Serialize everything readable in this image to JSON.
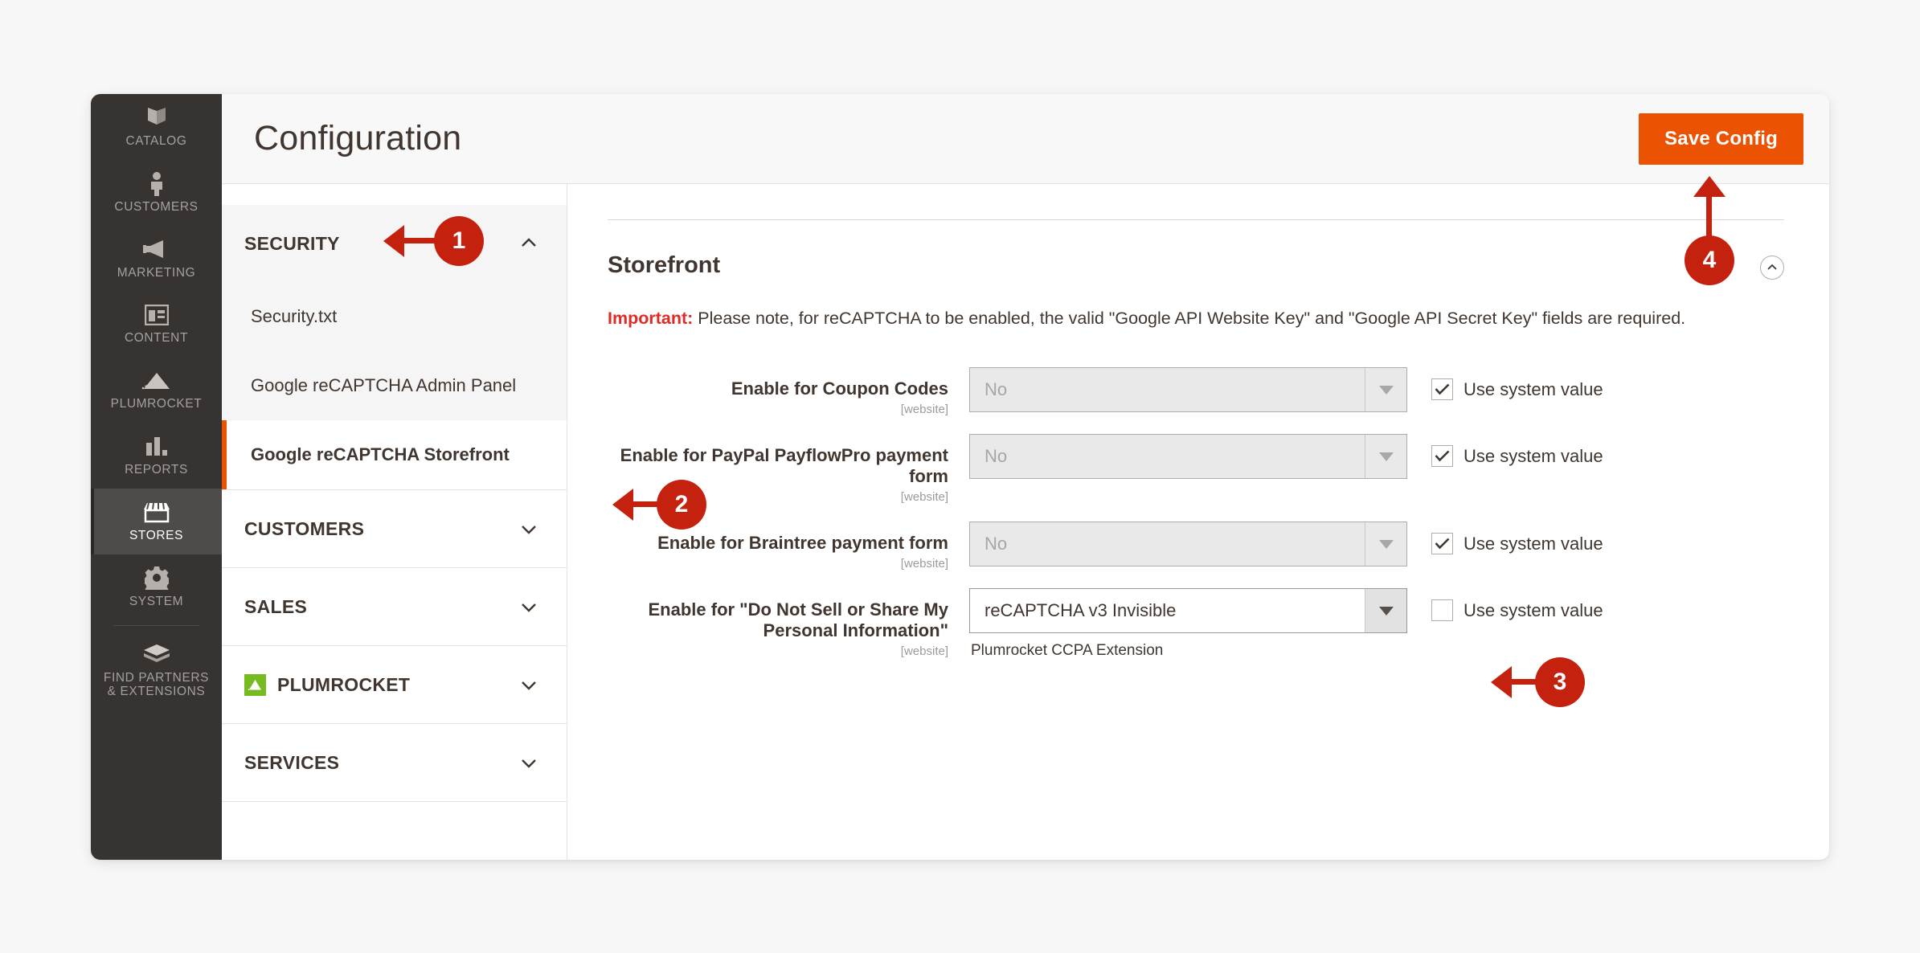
{
  "sidebar": {
    "items": [
      {
        "label": "CATALOG",
        "icon": "catalog-icon",
        "active": false
      },
      {
        "label": "CUSTOMERS",
        "icon": "customers-icon",
        "active": false
      },
      {
        "label": "MARKETING",
        "icon": "marketing-icon",
        "active": false
      },
      {
        "label": "CONTENT",
        "icon": "content-icon",
        "active": false
      },
      {
        "label": "PLUMROCKET",
        "icon": "plumrocket-icon",
        "active": false
      },
      {
        "label": "REPORTS",
        "icon": "reports-icon",
        "active": false
      },
      {
        "label": "STORES",
        "icon": "stores-icon",
        "active": true
      },
      {
        "label": "SYSTEM",
        "icon": "system-gear-icon",
        "active": false
      },
      {
        "label": "FIND PARTNERS\n& EXTENSIONS",
        "icon": "find-partners-icon",
        "active": false
      }
    ]
  },
  "header": {
    "title": "Configuration",
    "save_label": "Save Config"
  },
  "accordion": {
    "sections": [
      {
        "title": "SECURITY",
        "open": true,
        "chevron": "chevron-up-icon",
        "links": [
          {
            "label": "Security.txt",
            "current": false
          },
          {
            "label": "Google reCAPTCHA Admin Panel",
            "current": false
          },
          {
            "label": "Google reCAPTCHA Storefront",
            "current": true
          }
        ]
      },
      {
        "title": "CUSTOMERS",
        "open": false,
        "chevron": "chevron-down-icon",
        "links": []
      },
      {
        "title": "SALES",
        "open": false,
        "chevron": "chevron-down-icon",
        "links": []
      },
      {
        "title": "PLUMROCKET",
        "open": false,
        "chevron": "chevron-down-icon",
        "icon": "plumrocket-logo-icon",
        "links": []
      },
      {
        "title": "SERVICES",
        "open": false,
        "chevron": "chevron-down-icon",
        "links": []
      }
    ]
  },
  "content": {
    "section_title": "Storefront",
    "collapse_icon": "chevron-up-circle-icon",
    "note": {
      "important_label": "Important:",
      "text": " Please note, for reCAPTCHA to be enabled, the valid \"Google API Website Key\" and \"Google API Secret Key\" fields are required."
    },
    "scope_label": "[website]",
    "use_system_label": "Use system value",
    "fields": [
      {
        "label": "Enable for Coupon Codes",
        "scope": "[website]",
        "value": "No",
        "enabled": false,
        "use_system": true,
        "hint": ""
      },
      {
        "label": "Enable for PayPal PayflowPro payment form",
        "scope": "[website]",
        "value": "No",
        "enabled": false,
        "use_system": true,
        "hint": ""
      },
      {
        "label": "Enable for Braintree payment form",
        "scope": "[website]",
        "value": "No",
        "enabled": false,
        "use_system": true,
        "hint": ""
      },
      {
        "label": "Enable for \"Do Not Sell or Share My Personal Information\"",
        "scope": "[website]",
        "value": "reCAPTCHA v3 Invisible",
        "enabled": true,
        "use_system": false,
        "hint": "Plumrocket CCPA Extension"
      }
    ]
  },
  "callouts": [
    {
      "number": "1",
      "target": "security-accordion-header"
    },
    {
      "number": "2",
      "target": "google-recaptcha-storefront-link"
    },
    {
      "number": "3",
      "target": "ccpa-select-arrow"
    },
    {
      "number": "4",
      "target": "save-config-button"
    }
  ],
  "colors": {
    "accent_orange": "#eb5202",
    "callout_red": "#c4210e",
    "important_red": "#e02b27",
    "sidebar_dark": "#373330",
    "plumrocket_green": "#76bc21"
  }
}
